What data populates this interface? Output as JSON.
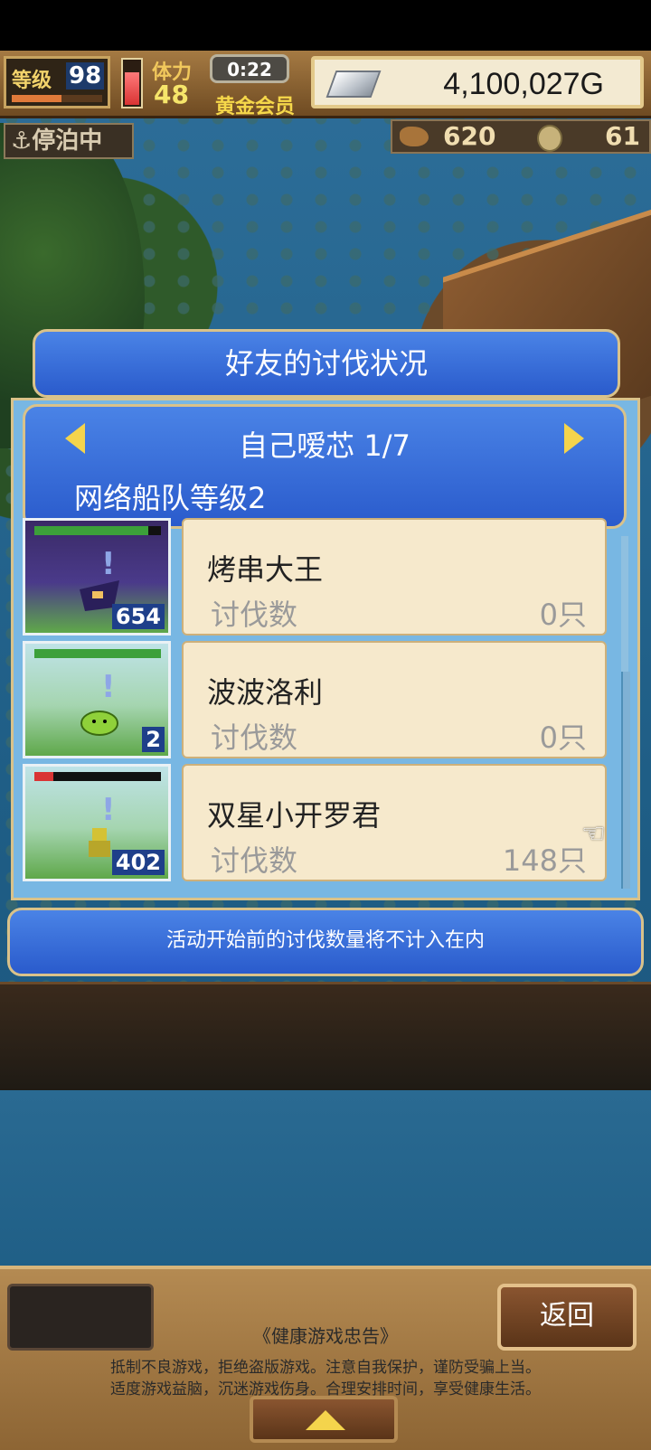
{
  "hud": {
    "level_label": "等级",
    "level_value": "98",
    "level_progress": 0.55,
    "hp_fraction": 0.7,
    "stamina_label": "体力",
    "stamina_value": "48",
    "timer": "0:22",
    "member_status": "黄金会员",
    "money": "4,100,027G",
    "docked_label": "⚓停泊中",
    "resource_ore": "620",
    "resource_coin": "61"
  },
  "dialog": {
    "title": "好友的讨伐状况",
    "player": "自己嗳芯 1/7",
    "fleet_level": "网络船队等级2",
    "notice": "活动开始前的讨伐数量将不计入在内"
  },
  "entries": [
    {
      "name": "烤串大王",
      "label": "讨伐数",
      "value": "0只",
      "count": "654",
      "hp": 0.9,
      "bg": "#3a2a66"
    },
    {
      "name": "波波洛利",
      "label": "讨伐数",
      "value": "0只",
      "count": "2",
      "hp": 1.0,
      "bg": "#9fd3cf"
    },
    {
      "name": "双星小开罗君",
      "label": "讨伐数",
      "value": "148只",
      "count": "402",
      "hp": 0.15,
      "bg": "#9fd3cf"
    }
  ],
  "bottom": {
    "back_label": "返回",
    "health_title": "《健康游戏忠告》",
    "health_line1": "抵制不良游戏，拒绝盗版游戏。注意自我保护，谨防受骗上当。",
    "health_line2": "适度游戏益脑，沉迷游戏伤身。合理安排时间，享受健康生活。"
  },
  "colors": {
    "dialog_blue": "#2a5bcc",
    "panel_blue": "#78b7e3",
    "card_cream": "#f6e9cc",
    "gold_text": "#f6d84a"
  }
}
